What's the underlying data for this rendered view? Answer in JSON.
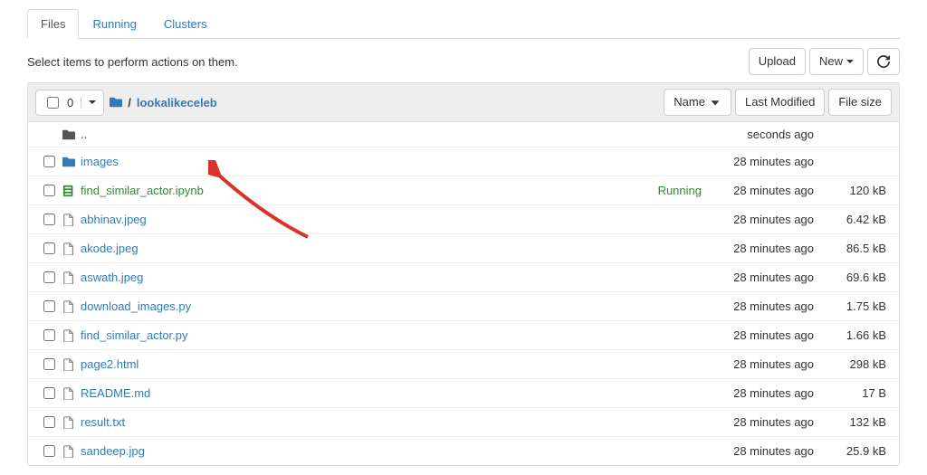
{
  "tabs": {
    "files": "Files",
    "running": "Running",
    "clusters": "Clusters"
  },
  "hint": "Select items to perform actions on them.",
  "buttons": {
    "upload": "Upload",
    "new": "New"
  },
  "selectCount": "0",
  "breadcrumb": {
    "folder": "lookalikeceleb"
  },
  "headers": {
    "name": "Name",
    "lastModified": "Last Modified",
    "filesize": "File size"
  },
  "updir": {
    "label": "..",
    "modified": "seconds ago"
  },
  "rows": [
    {
      "type": "folder",
      "name": "images",
      "status": "",
      "modified": "28 minutes ago",
      "size": ""
    },
    {
      "type": "notebook",
      "name": "find_similar_actor.ipynb",
      "status": "Running",
      "modified": "28 minutes ago",
      "size": "120 kB"
    },
    {
      "type": "file",
      "name": "abhinav.jpeg",
      "status": "",
      "modified": "28 minutes ago",
      "size": "6.42 kB"
    },
    {
      "type": "file",
      "name": "akode.jpeg",
      "status": "",
      "modified": "28 minutes ago",
      "size": "86.5 kB"
    },
    {
      "type": "file",
      "name": "aswath.jpeg",
      "status": "",
      "modified": "28 minutes ago",
      "size": "69.6 kB"
    },
    {
      "type": "file",
      "name": "download_images.py",
      "status": "",
      "modified": "28 minutes ago",
      "size": "1.75 kB"
    },
    {
      "type": "file",
      "name": "find_similar_actor.py",
      "status": "",
      "modified": "28 minutes ago",
      "size": "1.66 kB"
    },
    {
      "type": "file",
      "name": "page2.html",
      "status": "",
      "modified": "28 minutes ago",
      "size": "298 kB"
    },
    {
      "type": "file",
      "name": "README.md",
      "status": "",
      "modified": "28 minutes ago",
      "size": "17 B"
    },
    {
      "type": "file",
      "name": "result.txt",
      "status": "",
      "modified": "28 minutes ago",
      "size": "132 kB"
    },
    {
      "type": "file",
      "name": "sandeep.jpg",
      "status": "",
      "modified": "28 minutes ago",
      "size": "25.9 kB"
    }
  ]
}
